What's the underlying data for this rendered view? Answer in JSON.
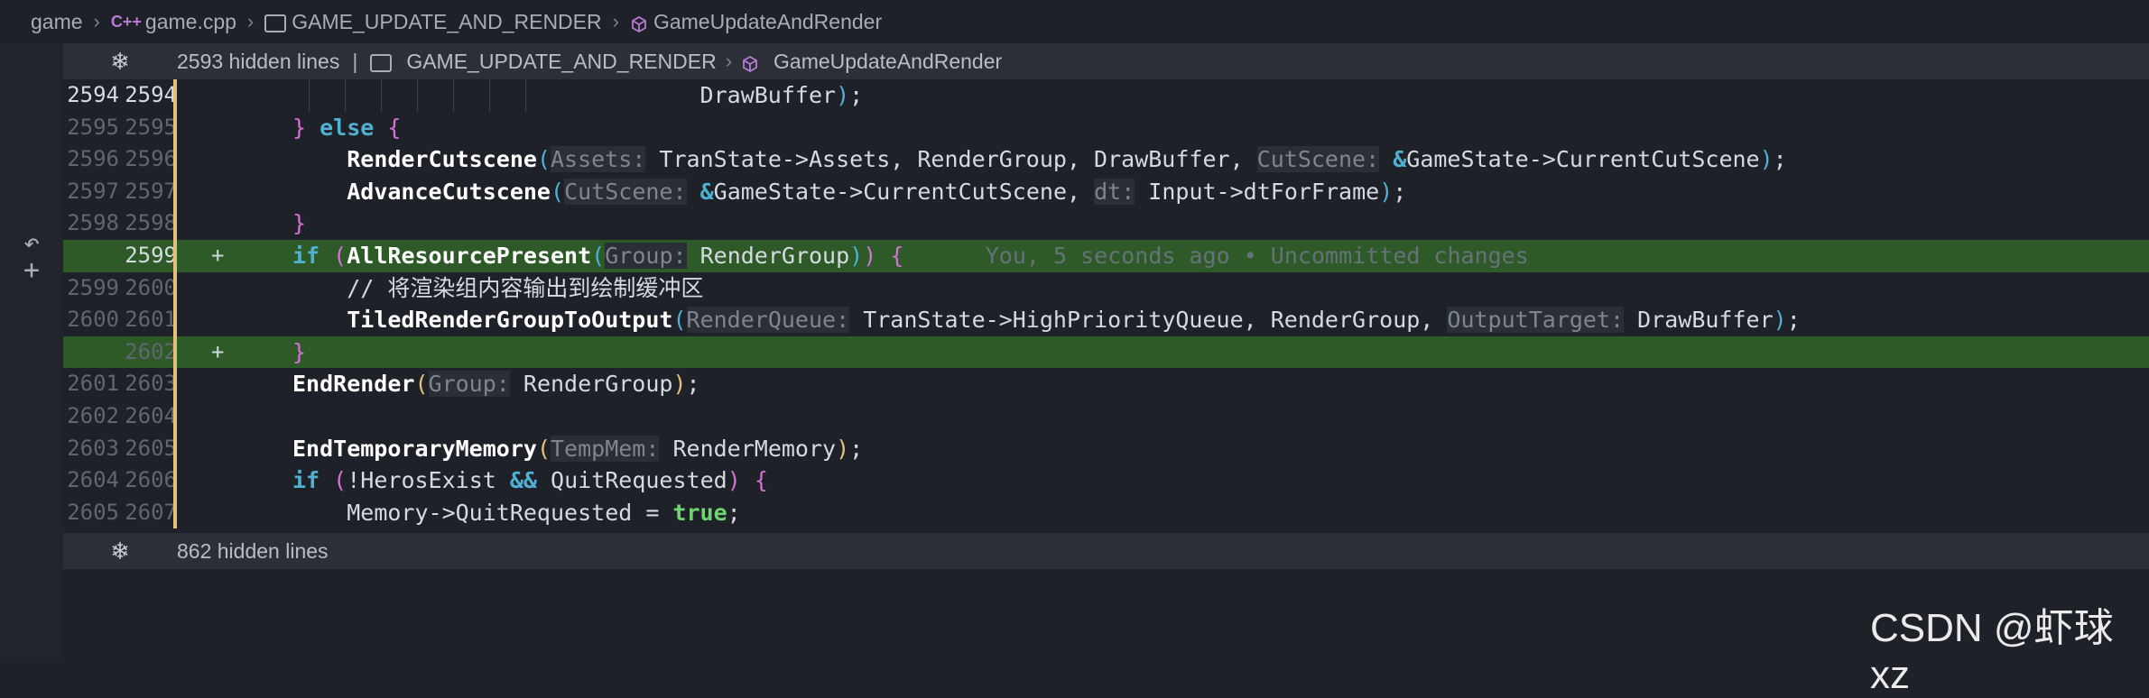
{
  "breadcrumb": {
    "folder": "game",
    "file_icon": "C++",
    "file": "game.cpp",
    "namespace": "GAME_UPDATE_AND_RENDER",
    "function": "GameUpdateAndRender"
  },
  "fold_top": {
    "text": "2593 hidden lines",
    "sep": "|",
    "namespace": "GAME_UPDATE_AND_RENDER",
    "function": "GameUpdateAndRender"
  },
  "fold_bottom": {
    "text": "862 hidden lines"
  },
  "lines": [
    {
      "l1": "2594",
      "l2": "2594",
      "plus": "",
      "added": false,
      "cur": true,
      "code": [
        {
          "c": "v",
          "t": "DrawBuffer"
        },
        {
          "c": "p3",
          "t": ")"
        },
        {
          "c": "v",
          "t": ";"
        }
      ],
      "indent": "            "
    },
    {
      "l1": "2595",
      "l2": "2595",
      "plus": "",
      "added": false,
      "code": [
        {
          "c": "p2",
          "t": "} "
        },
        {
          "c": "kw2",
          "t": "else"
        },
        {
          "c": "v",
          "t": " "
        },
        {
          "c": "p2",
          "t": "{"
        }
      ],
      "indent": ""
    },
    {
      "l1": "2596",
      "l2": "2596",
      "plus": "",
      "added": false,
      "code": [
        {
          "c": "fn",
          "t": "RenderCutscene"
        },
        {
          "c": "p3",
          "t": "("
        },
        {
          "c": "hint",
          "t": "Assets:"
        },
        {
          "c": "v",
          "t": " TranState->Assets, RenderGroup, DrawBuffer, "
        },
        {
          "c": "hint",
          "t": "CutScene:"
        },
        {
          "c": "v",
          "t": " "
        },
        {
          "c": "amp",
          "t": "&"
        },
        {
          "c": "v",
          "t": "GameState->CurrentCutScene"
        },
        {
          "c": "p3",
          "t": ")"
        },
        {
          "c": "v",
          "t": ";"
        }
      ],
      "indent": "    "
    },
    {
      "l1": "2597",
      "l2": "2597",
      "plus": "",
      "added": false,
      "code": [
        {
          "c": "fn",
          "t": "AdvanceCutscene"
        },
        {
          "c": "p3",
          "t": "("
        },
        {
          "c": "hint",
          "t": "CutScene:"
        },
        {
          "c": "v",
          "t": " "
        },
        {
          "c": "amp",
          "t": "&"
        },
        {
          "c": "v",
          "t": "GameState->CurrentCutScene, "
        },
        {
          "c": "hint",
          "t": "dt:"
        },
        {
          "c": "v",
          "t": " Input->dtForFrame"
        },
        {
          "c": "p3",
          "t": ")"
        },
        {
          "c": "v",
          "t": ";"
        }
      ],
      "indent": "    "
    },
    {
      "l1": "2598",
      "l2": "2598",
      "plus": "",
      "added": false,
      "code": [
        {
          "c": "p2",
          "t": "}"
        }
      ],
      "indent": ""
    },
    {
      "l1": "",
      "l2": "2599",
      "plus": "+",
      "added": true,
      "cur2": true,
      "code": [
        {
          "c": "kw2",
          "t": "if"
        },
        {
          "c": "v",
          "t": " "
        },
        {
          "c": "p2",
          "t": "("
        },
        {
          "c": "fn",
          "t": "AllResourcePresent"
        },
        {
          "c": "p3",
          "t": "("
        },
        {
          "c": "hint",
          "t": "Group:"
        },
        {
          "c": "v",
          "t": " RenderGroup"
        },
        {
          "c": "p3",
          "t": ")"
        },
        {
          "c": "p2",
          "t": ")"
        },
        {
          "c": "v",
          "t": " "
        },
        {
          "c": "p2",
          "t": "{"
        },
        {
          "c": "blame",
          "t": "      You, 5 seconds ago • Uncommitted changes"
        }
      ],
      "indent": ""
    },
    {
      "l1": "2599",
      "l2": "2600",
      "plus": "",
      "added": false,
      "code": [
        {
          "c": "cm",
          "t": "// 将渲染组内容输出到绘制缓冲区"
        }
      ],
      "indent": "    "
    },
    {
      "l1": "2600",
      "l2": "2601",
      "plus": "",
      "added": false,
      "code": [
        {
          "c": "fn",
          "t": "TiledRenderGroupToOutput"
        },
        {
          "c": "p3",
          "t": "("
        },
        {
          "c": "hint",
          "t": "RenderQueue:"
        },
        {
          "c": "v",
          "t": " TranState->HighPriorityQueue, RenderGroup, "
        },
        {
          "c": "hint",
          "t": "OutputTarget:"
        },
        {
          "c": "v",
          "t": " DrawBuffer"
        },
        {
          "c": "p3",
          "t": ")"
        },
        {
          "c": "v",
          "t": ";"
        }
      ],
      "indent": "    "
    },
    {
      "l1": "",
      "l2": "2602",
      "plus": "+",
      "added": true,
      "code": [
        {
          "c": "p2",
          "t": "}"
        }
      ],
      "indent": ""
    },
    {
      "l1": "2601",
      "l2": "2603",
      "plus": "",
      "added": false,
      "code": [
        {
          "c": "fn",
          "t": "EndRender"
        },
        {
          "c": "p1",
          "t": "("
        },
        {
          "c": "hint",
          "t": "Group:"
        },
        {
          "c": "v",
          "t": " RenderGroup"
        },
        {
          "c": "p1",
          "t": ")"
        },
        {
          "c": "v",
          "t": ";"
        }
      ],
      "indent": ""
    },
    {
      "l1": "2602",
      "l2": "2604",
      "plus": "",
      "added": false,
      "code": [],
      "indent": ""
    },
    {
      "l1": "2603",
      "l2": "2605",
      "plus": "",
      "added": false,
      "code": [
        {
          "c": "fn",
          "t": "EndTemporaryMemory"
        },
        {
          "c": "p1",
          "t": "("
        },
        {
          "c": "hint",
          "t": "TempMem:"
        },
        {
          "c": "v",
          "t": " RenderMemory"
        },
        {
          "c": "p1",
          "t": ")"
        },
        {
          "c": "v",
          "t": ";"
        }
      ],
      "indent": ""
    },
    {
      "l1": "2604",
      "l2": "2606",
      "plus": "",
      "added": false,
      "code": [
        {
          "c": "kw2",
          "t": "if"
        },
        {
          "c": "v",
          "t": " "
        },
        {
          "c": "p2",
          "t": "("
        },
        {
          "c": "v",
          "t": "!HerosExist "
        },
        {
          "c": "amp",
          "t": "&&"
        },
        {
          "c": "v",
          "t": " QuitRequested"
        },
        {
          "c": "p2",
          "t": ")"
        },
        {
          "c": "v",
          "t": " "
        },
        {
          "c": "p2",
          "t": "{"
        }
      ],
      "indent": ""
    },
    {
      "l1": "2605",
      "l2": "2607",
      "plus": "",
      "added": false,
      "code": [
        {
          "c": "v",
          "t": "Memory->QuitRequested = "
        },
        {
          "c": "tr",
          "t": "true"
        },
        {
          "c": "v",
          "t": ";"
        }
      ],
      "indent": "    "
    }
  ],
  "watermark": "CSDN @虾球xz"
}
